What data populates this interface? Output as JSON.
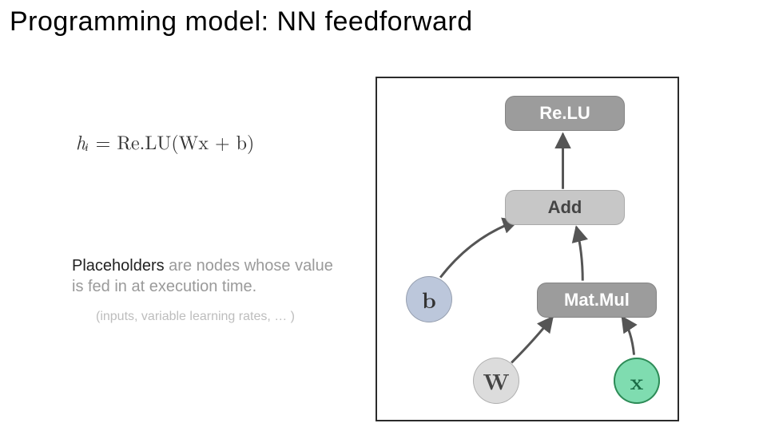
{
  "title": "Programming model: NN feedforward",
  "equation": {
    "lhs": "hᵢ",
    "rhs": "Re.LU(Wx + b)"
  },
  "body": {
    "strong": "Placeholders",
    "rest": " are nodes whose value is fed in at execution time."
  },
  "sub": "(inputs, variable learning rates, … )",
  "diagram": {
    "ops": {
      "relu": "Re.LU",
      "add": "Add",
      "matmul": "Mat.Mul"
    },
    "vars": {
      "b": "b",
      "w": "W",
      "x": "x"
    },
    "edges": [
      {
        "from": "add",
        "to": "relu"
      },
      {
        "from": "matmul",
        "to": "add"
      },
      {
        "from": "b",
        "to": "add"
      },
      {
        "from": "w",
        "to": "matmul"
      },
      {
        "from": "x",
        "to": "matmul"
      }
    ]
  }
}
